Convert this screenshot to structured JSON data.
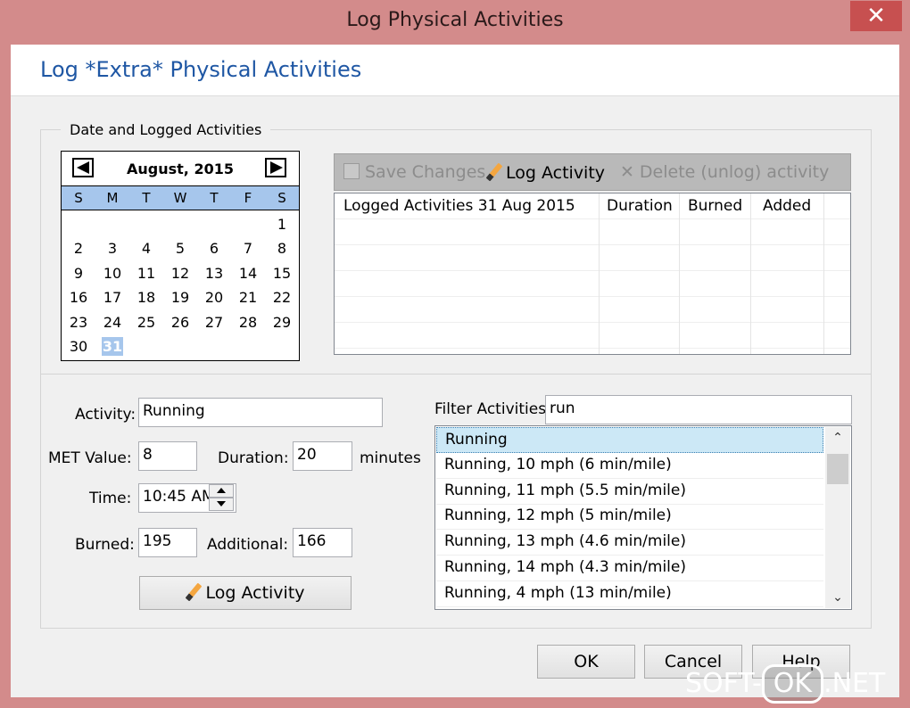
{
  "window": {
    "title": "Log Physical Activities",
    "close_glyph": "✕"
  },
  "header": {
    "title": "Log *Extra* Physical Activities"
  },
  "group": {
    "legend": "Date and Logged Activities"
  },
  "calendar": {
    "month_label": "August, 2015",
    "weekdays": [
      "S",
      "M",
      "T",
      "W",
      "T",
      "F",
      "S"
    ],
    "leading_blanks": 6,
    "days": [
      "1",
      "2",
      "3",
      "4",
      "5",
      "6",
      "7",
      "8",
      "9",
      "10",
      "11",
      "12",
      "13",
      "14",
      "15",
      "16",
      "17",
      "18",
      "19",
      "20",
      "21",
      "22",
      "23",
      "24",
      "25",
      "26",
      "27",
      "28",
      "29",
      "30",
      "31"
    ],
    "selected_day": "31"
  },
  "toolbar": {
    "save_label": "Save Changes",
    "log_label": "Log Activity",
    "delete_label": "Delete (unlog) activity"
  },
  "logged_table": {
    "columns": [
      "Logged Activities 31 Aug 2015",
      "Duration",
      "Burned",
      "Added"
    ],
    "rows": []
  },
  "form": {
    "activity_label": "Activity:",
    "activity_value": "Running",
    "met_label": "MET Value:",
    "met_value": "8",
    "duration_label": "Duration:",
    "duration_value": "20",
    "duration_unit": "minutes",
    "time_label": "Time:",
    "time_value": "10:45 AM",
    "burned_label": "Burned:",
    "burned_value": "195",
    "additional_label": "Additional:",
    "additional_value": "166",
    "log_button": "Log Activity"
  },
  "filter": {
    "label": "Filter Activities:",
    "value": "run",
    "items": [
      "Running",
      "Running, 10 mph (6 min/mile)",
      "Running, 11 mph (5.5 min/mile)",
      "Running, 12 mph (5 min/mile)",
      "Running, 13 mph (4.6 min/mile)",
      "Running, 14 mph (4.3 min/mile)",
      "Running, 4 mph (13 min/mile)"
    ],
    "selected_index": 0
  },
  "buttons": {
    "ok": "OK",
    "cancel": "Cancel",
    "help": "Help"
  },
  "watermark": {
    "left": "SOFT-",
    "box": "OK",
    "right": ".NET"
  },
  "colors": {
    "title_blue": "#1f57a4",
    "frame": "#d38b8b",
    "close_red": "#c75050",
    "calendar_header": "#a6c6ec",
    "selection": "#cce8f6"
  }
}
